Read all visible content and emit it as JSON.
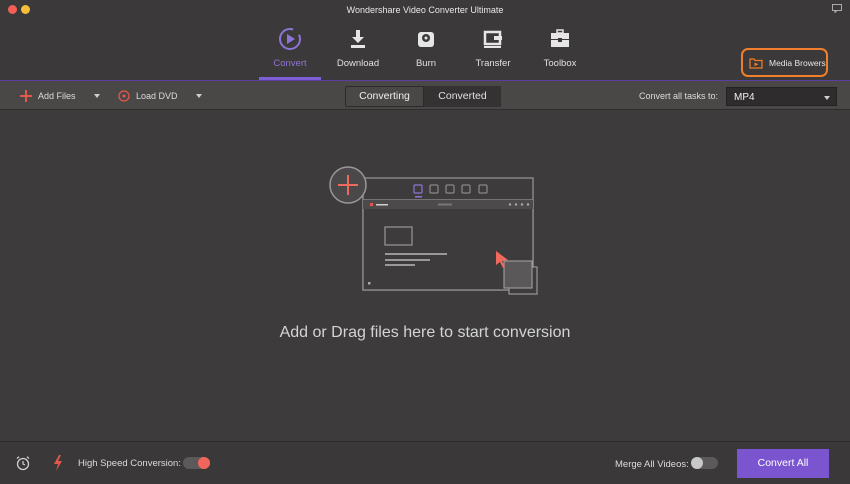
{
  "window": {
    "title": "Wondershare Video Converter Ultimate"
  },
  "nav": {
    "tabs": [
      {
        "label": "Convert",
        "icon": "convert-icon",
        "active": true
      },
      {
        "label": "Download",
        "icon": "download-icon",
        "active": false
      },
      {
        "label": "Burn",
        "icon": "burn-icon",
        "active": false
      },
      {
        "label": "Transfer",
        "icon": "transfer-icon",
        "active": false
      },
      {
        "label": "Toolbox",
        "icon": "toolbox-icon",
        "active": false
      }
    ],
    "media_browser_label": "Media Browers"
  },
  "toolbar": {
    "add_files_label": "Add Files",
    "load_dvd_label": "Load DVD",
    "segments": [
      "Converting",
      "Converted"
    ],
    "active_segment": "Converting",
    "convert_all_label": "Convert all tasks to:",
    "format_value": "MP4"
  },
  "main": {
    "drop_text": "Add or Drag files here to start conversion"
  },
  "bottom": {
    "high_speed_label": "High Speed Conversion:",
    "high_speed_on": true,
    "merge_label": "Merge All Videos:",
    "merge_on": false,
    "convert_all_button": "Convert All"
  },
  "colors": {
    "accent": "#7a55cf",
    "media_border": "#ef7f2a",
    "toggle_on": "#f2655a"
  }
}
